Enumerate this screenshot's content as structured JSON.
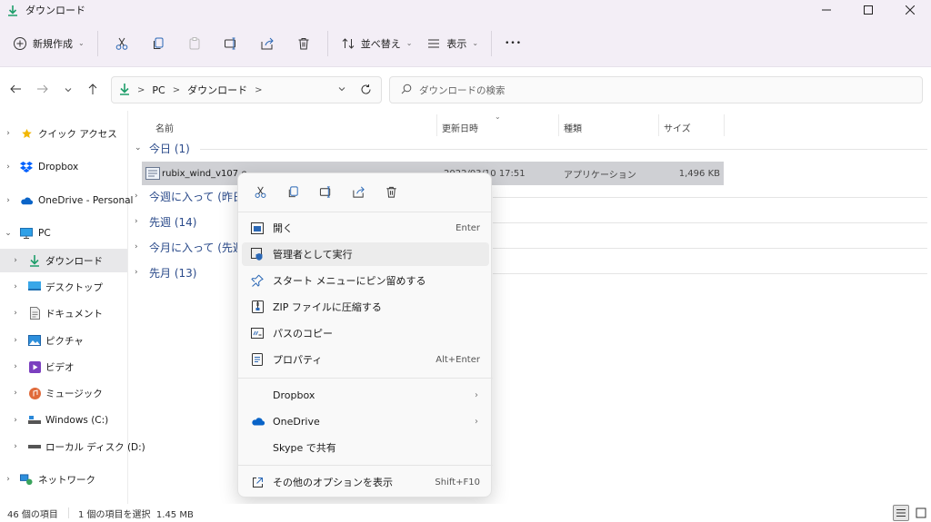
{
  "window": {
    "title": "ダウンロード",
    "minimize": "—",
    "maximize": "□",
    "close": "✕"
  },
  "toolbar": {
    "new_label": "新規作成",
    "sort_label": "並べ替え",
    "view_label": "表示",
    "more_label": "•••"
  },
  "address": {
    "crumbs": [
      "PC",
      "ダウンロード"
    ],
    "sep": ">",
    "search_placeholder": "ダウンロードの検索"
  },
  "sidebar": {
    "items": [
      {
        "label": "クイック アクセス"
      },
      {
        "label": "Dropbox"
      },
      {
        "label": "OneDrive - Personal"
      },
      {
        "label": "PC"
      },
      {
        "label": "ダウンロード"
      },
      {
        "label": "デスクトップ"
      },
      {
        "label": "ドキュメント"
      },
      {
        "label": "ピクチャ"
      },
      {
        "label": "ビデオ"
      },
      {
        "label": "ミュージック"
      },
      {
        "label": "Windows (C:)"
      },
      {
        "label": "ローカル ディスク (D:)"
      },
      {
        "label": "ネットワーク"
      }
    ]
  },
  "columns": {
    "name": "名前",
    "date": "更新日時",
    "type": "種類",
    "size": "サイズ"
  },
  "groups": [
    {
      "label": "今日 (1)"
    },
    {
      "label": "今週に入って (昨日"
    },
    {
      "label": "先週 (14)"
    },
    {
      "label": "今月に入って (先週"
    },
    {
      "label": "先月 (13)"
    }
  ],
  "file": {
    "name": "rubix_wind_v107.e",
    "date": "2022/03/10 17:51",
    "type": "アプリケーション",
    "size": "1,496 KB"
  },
  "context_menu": {
    "items": [
      {
        "label": "開く",
        "shortcut": "Enter"
      },
      {
        "label": "管理者として実行"
      },
      {
        "label": "スタート メニューにピン留めする"
      },
      {
        "label": "ZIP ファイルに圧縮する"
      },
      {
        "label": "パスのコピー"
      },
      {
        "label": "プロパティ",
        "shortcut": "Alt+Enter"
      },
      {
        "label": "Dropbox"
      },
      {
        "label": "OneDrive"
      },
      {
        "label": "Skype で共有"
      },
      {
        "label": "その他のオプションを表示",
        "shortcut": "Shift+F10"
      }
    ]
  },
  "status": {
    "count": "46 個の項目",
    "selected": "1 個の項目を選択  1.45 MB"
  },
  "colors": {
    "accent": "#0067c0",
    "download_green": "#1e9e6a",
    "titlebar_bg": "#f3eef6",
    "selection_gray": "#cfd0d4"
  }
}
